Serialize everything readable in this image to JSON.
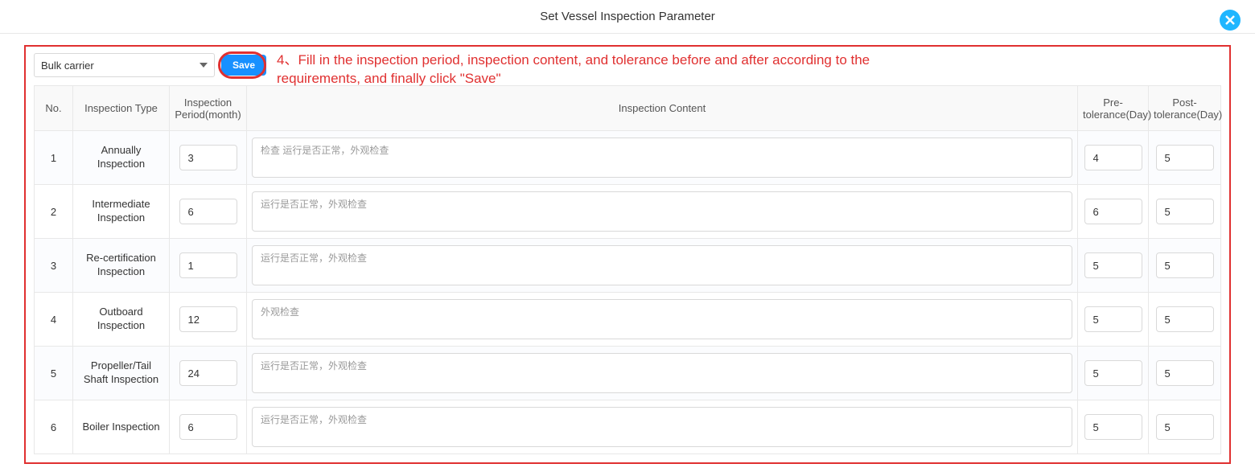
{
  "header": {
    "title": "Set Vessel Inspection Parameter"
  },
  "toolbar": {
    "vessel_select_value": "Bulk carrier",
    "save_label": "Save"
  },
  "annotation": {
    "text": "4、Fill in the inspection period, inspection content, and tolerance before and after according to the requirements, and finally click \"Save\""
  },
  "table": {
    "headers": {
      "no": "No.",
      "type": "Inspection Type",
      "period": "Inspection Period(month)",
      "content": "Inspection Content",
      "pre": "Pre-tolerance(Day)",
      "post": "Post-tolerance(Day)"
    },
    "rows": [
      {
        "no": "1",
        "type": "Annually Inspection",
        "period": "3",
        "content": "检查 运行是否正常，外观检查",
        "pre": "4",
        "post": "5"
      },
      {
        "no": "2",
        "type": "Intermediate Inspection",
        "period": "6",
        "content": "运行是否正常，外观检查",
        "pre": "6",
        "post": "5"
      },
      {
        "no": "3",
        "type": "Re-certification Inspection",
        "period": "1",
        "content": "运行是否正常，外观检查",
        "pre": "5",
        "post": "5"
      },
      {
        "no": "4",
        "type": "Outboard Inspection",
        "period": "12",
        "content": "外观检查",
        "pre": "5",
        "post": "5"
      },
      {
        "no": "5",
        "type": "Propeller/Tail Shaft Inspection",
        "period": "24",
        "content": "运行是否正常，外观检查",
        "pre": "5",
        "post": "5"
      },
      {
        "no": "6",
        "type": "Boiler Inspection",
        "period": "6",
        "content": "运行是否正常，外观检查",
        "pre": "5",
        "post": "5"
      }
    ]
  }
}
